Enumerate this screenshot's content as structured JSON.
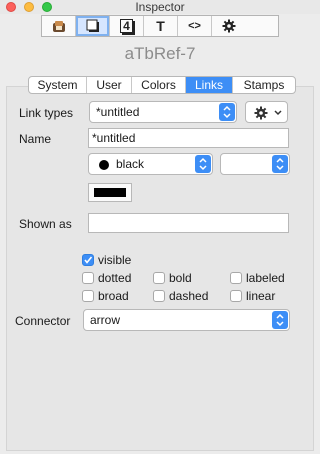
{
  "window": {
    "title": "Inspector"
  },
  "toolbar": {
    "items": [
      {
        "name": "appearance-icon"
      },
      {
        "name": "document-icon"
      },
      {
        "name": "action-icon",
        "glyph": "4"
      },
      {
        "name": "text-icon",
        "glyph": "T"
      },
      {
        "name": "code-icon",
        "glyph": "<>"
      },
      {
        "name": "gear-icon",
        "glyph": "✲"
      }
    ],
    "selected_index": 1
  },
  "document": {
    "title": "aTbRef-7"
  },
  "tabs": {
    "items": [
      "System",
      "User",
      "Colors",
      "Links",
      "Stamps"
    ],
    "active": "Links"
  },
  "form": {
    "link_types": {
      "label": "Link types",
      "value": "*untitled"
    },
    "name": {
      "label": "Name",
      "value": "*untitled"
    },
    "color": {
      "value": "black",
      "secondary_value": ""
    },
    "swatch_color": "#000000",
    "shown_as": {
      "label": "Shown as",
      "value": ""
    },
    "checkboxes": [
      {
        "label": "visible",
        "checked": true
      },
      {
        "label": "dotted",
        "checked": false
      },
      {
        "label": "bold",
        "checked": false
      },
      {
        "label": "labeled",
        "checked": false
      },
      {
        "label": "broad",
        "checked": false
      },
      {
        "label": "dashed",
        "checked": false
      },
      {
        "label": "linear",
        "checked": false
      }
    ],
    "connector": {
      "label": "Connector",
      "value": "arrow"
    }
  },
  "colors": {
    "accent": "#3d8ef6"
  }
}
